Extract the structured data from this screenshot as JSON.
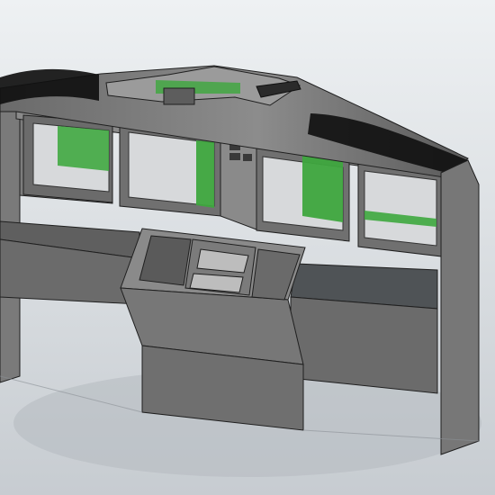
{
  "scene": {
    "colors": {
      "background_top": "#eef1f3",
      "background_bottom": "#c7ccd1",
      "floor_shadow": "#b4b9bf",
      "panel_light": "#7f7f7f",
      "panel_mid": "#6f6f6f",
      "panel_dark": "#4d4d4d",
      "edge": "#1f1f1f",
      "accent_green": "#3ea73e",
      "accent_green_dark": "#2b7f2b",
      "dark_fabric": "#101010"
    },
    "parts": [
      "overhead-panel",
      "left-wing-wall",
      "right-wing-wall",
      "display-bay-1",
      "display-bay-2",
      "display-bay-3",
      "display-bay-4",
      "center-pedestal",
      "left-desk-shelf",
      "right-desk-shelf"
    ]
  }
}
